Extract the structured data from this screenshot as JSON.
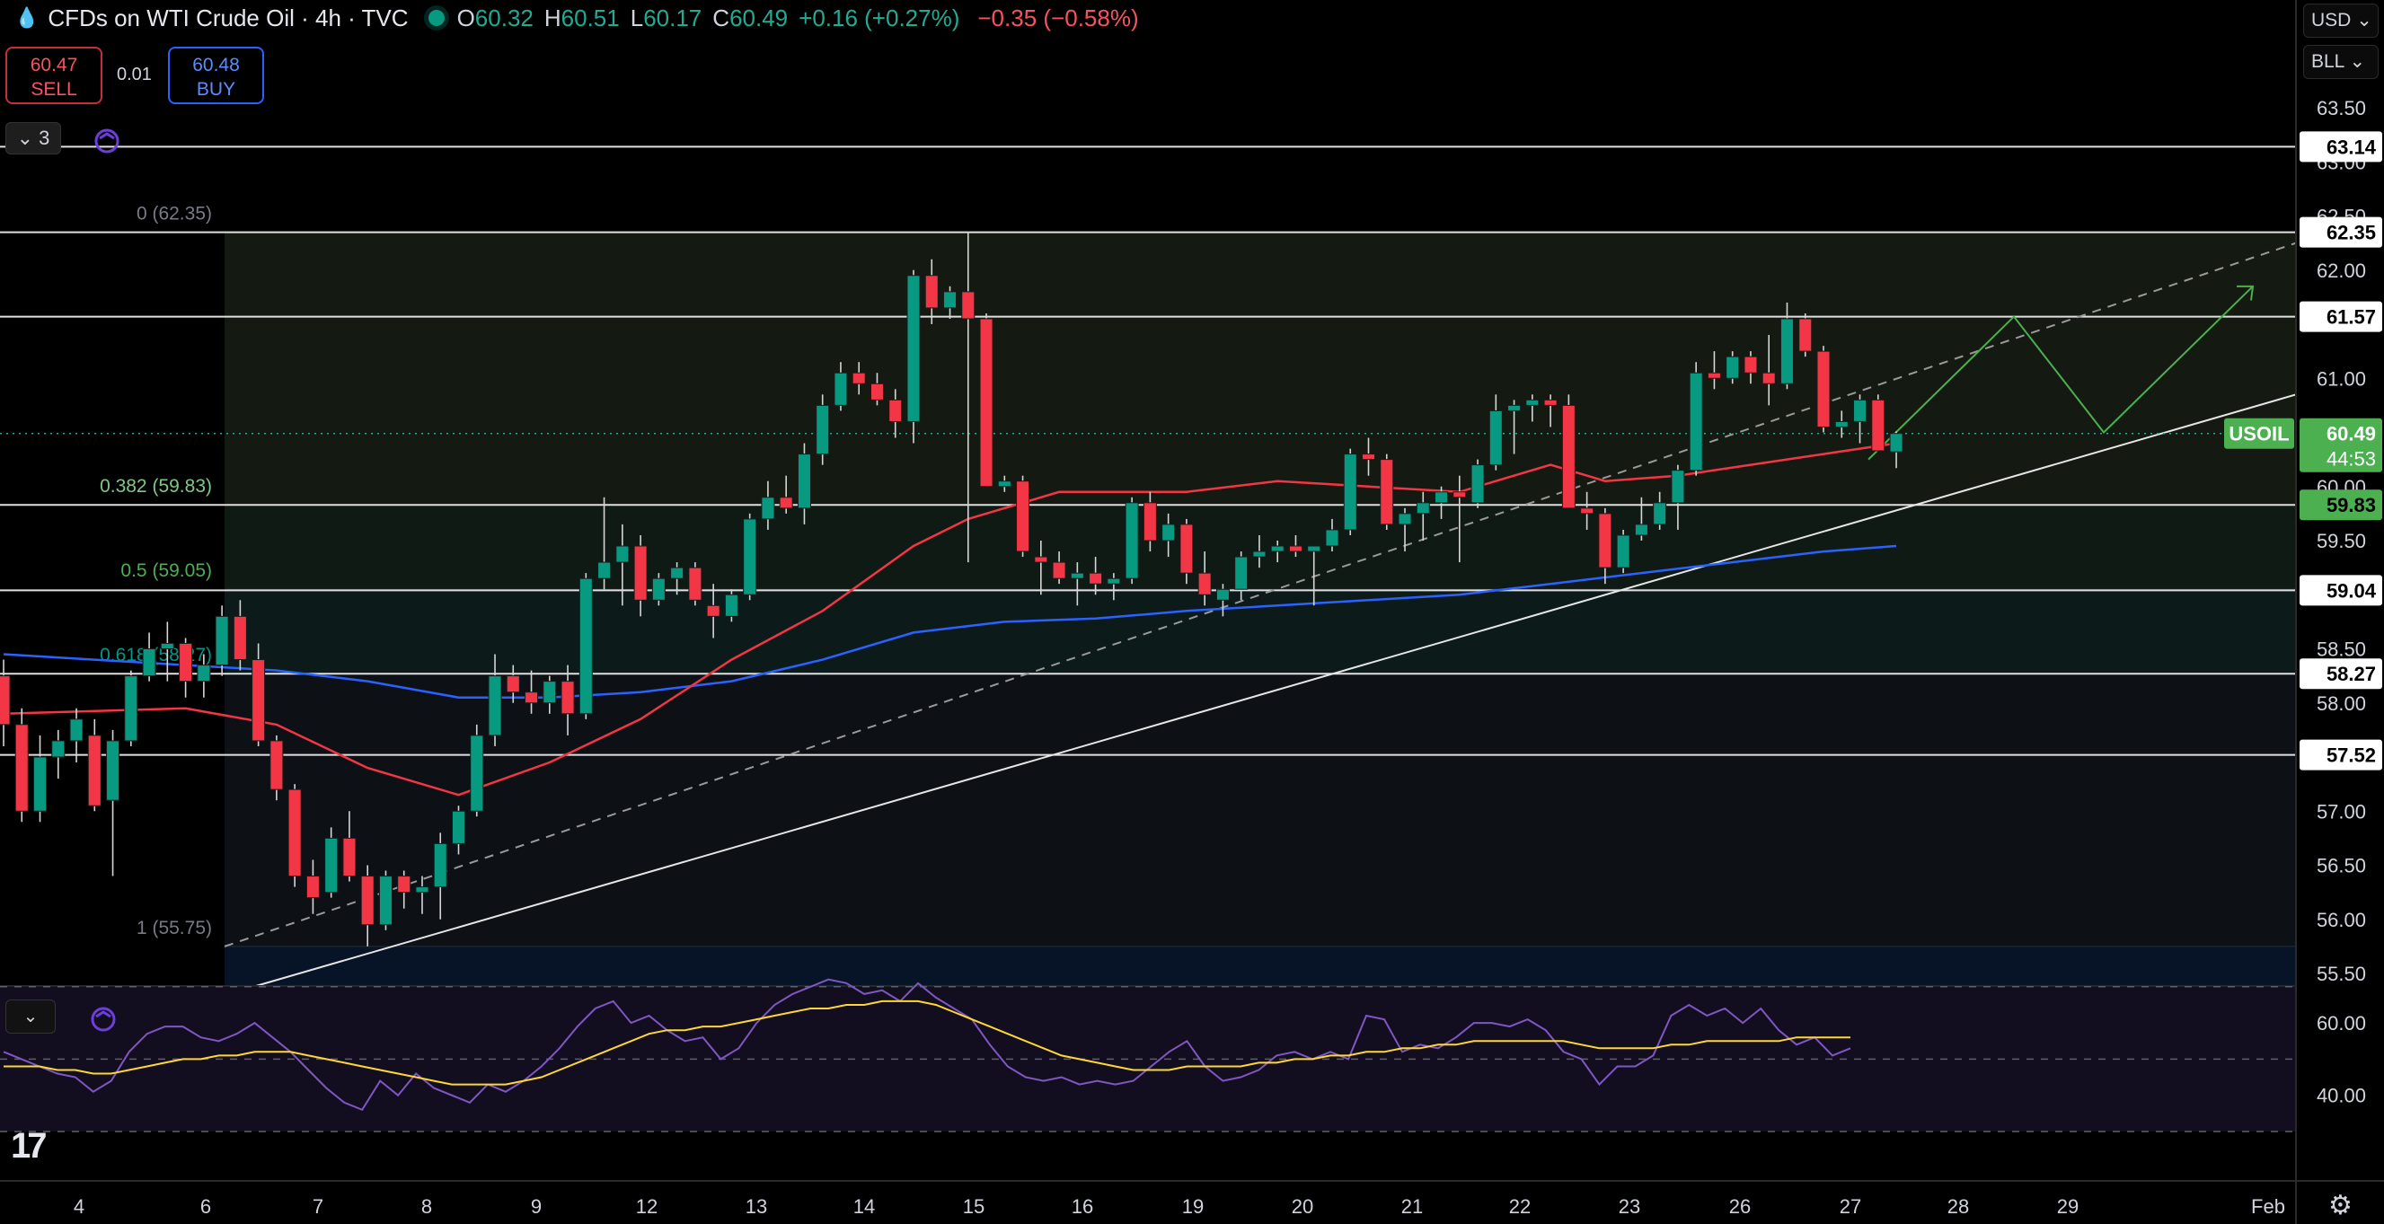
{
  "header": {
    "title": "CFDs on WTI Crude Oil · 4h · TVC",
    "open_label": "O",
    "open": "60.32",
    "high_label": "H",
    "high": "60.51",
    "low_label": "L",
    "low": "60.17",
    "close_label": "C",
    "close": "60.49",
    "change": "+0.16 (+0.27%)",
    "change2": "−0.35 (−0.58%)",
    "status_color": "#089981"
  },
  "trade": {
    "sell_price": "60.47",
    "sell_label": "SELL",
    "spread": "0.01",
    "buy_price": "60.48",
    "buy_label": "BUY"
  },
  "indicators_toggle": {
    "count": "3"
  },
  "currency_select": "USD",
  "unit_select": "BLL",
  "colors": {
    "up": "#089981",
    "down": "#f23645",
    "ma_fast": "#f23645",
    "ma_slow": "#2962ff",
    "rsi": "#7e57c2",
    "rsi_ma": "#fdd835",
    "projection": "#4caf50"
  },
  "chart_data": [
    {
      "type": "candlestick",
      "symbol": "USOIL",
      "timeframe": "4h",
      "x_ticks": [
        "4",
        "6",
        "7",
        "8",
        "9",
        "12",
        "13",
        "14",
        "15",
        "16",
        "19",
        "20",
        "21",
        "22",
        "23",
        "26",
        "27",
        "28",
        "29",
        "Feb"
      ],
      "y_ticks": [
        "63.50",
        "63.00",
        "62.50",
        "62.00",
        "61.50",
        "61.00",
        "60.50",
        "60.00",
        "59.50",
        "59.00",
        "58.50",
        "58.00",
        "57.50",
        "57.00",
        "56.50",
        "56.00",
        "55.50"
      ],
      "ylim": [
        55.4,
        63.9
      ],
      "candles": [
        [
          58.25,
          58.4,
          57.6,
          57.8
        ],
        [
          57.8,
          57.95,
          56.9,
          57.0
        ],
        [
          57.0,
          57.7,
          56.9,
          57.5
        ],
        [
          57.5,
          57.75,
          57.3,
          57.65
        ],
        [
          57.65,
          57.95,
          57.45,
          57.85
        ],
        [
          57.7,
          57.85,
          57.0,
          57.05
        ],
        [
          57.1,
          57.75,
          56.4,
          57.65
        ],
        [
          57.65,
          58.3,
          57.6,
          58.25
        ],
        [
          58.25,
          58.65,
          58.2,
          58.5
        ],
        [
          58.5,
          58.75,
          58.2,
          58.55
        ],
        [
          58.55,
          58.6,
          58.05,
          58.2
        ],
        [
          58.2,
          58.45,
          58.05,
          58.35
        ],
        [
          58.35,
          58.9,
          58.25,
          58.8
        ],
        [
          58.8,
          58.95,
          58.3,
          58.4
        ],
        [
          58.4,
          58.55,
          57.6,
          57.65
        ],
        [
          57.65,
          57.7,
          57.1,
          57.2
        ],
        [
          57.2,
          57.25,
          56.3,
          56.4
        ],
        [
          56.4,
          56.55,
          56.05,
          56.2
        ],
        [
          56.25,
          56.85,
          56.2,
          56.75
        ],
        [
          56.75,
          57.0,
          56.35,
          56.4
        ],
        [
          56.4,
          56.5,
          55.75,
          55.95
        ],
        [
          55.95,
          56.45,
          55.9,
          56.4
        ],
        [
          56.4,
          56.45,
          56.1,
          56.25
        ],
        [
          56.25,
          56.4,
          56.05,
          56.3
        ],
        [
          56.3,
          56.8,
          56.0,
          56.7
        ],
        [
          56.7,
          57.05,
          56.6,
          57.0
        ],
        [
          57.0,
          57.8,
          56.95,
          57.7
        ],
        [
          57.7,
          58.45,
          57.6,
          58.25
        ],
        [
          58.25,
          58.35,
          58.0,
          58.1
        ],
        [
          58.1,
          58.3,
          57.9,
          58.0
        ],
        [
          58.0,
          58.25,
          57.9,
          58.2
        ],
        [
          58.2,
          58.35,
          57.7,
          57.9
        ],
        [
          57.9,
          59.2,
          57.85,
          59.15
        ],
        [
          59.15,
          59.9,
          59.05,
          59.3
        ],
        [
          59.3,
          59.65,
          58.9,
          59.45
        ],
        [
          59.45,
          59.55,
          58.8,
          58.95
        ],
        [
          58.95,
          59.2,
          58.9,
          59.15
        ],
        [
          59.15,
          59.3,
          59.0,
          59.25
        ],
        [
          59.25,
          59.3,
          58.9,
          58.95
        ],
        [
          58.9,
          59.1,
          58.6,
          58.8
        ],
        [
          58.8,
          59.05,
          58.75,
          59.0
        ],
        [
          59.0,
          59.75,
          58.95,
          59.7
        ],
        [
          59.7,
          60.05,
          59.6,
          59.9
        ],
        [
          59.9,
          60.1,
          59.75,
          59.8
        ],
        [
          59.8,
          60.4,
          59.65,
          60.3
        ],
        [
          60.3,
          60.85,
          60.2,
          60.75
        ],
        [
          60.75,
          61.15,
          60.7,
          61.05
        ],
        [
          61.05,
          61.15,
          60.85,
          60.95
        ],
        [
          60.95,
          61.05,
          60.75,
          60.8
        ],
        [
          60.8,
          60.9,
          60.45,
          60.6
        ],
        [
          60.6,
          62.0,
          60.4,
          61.95
        ],
        [
          61.95,
          62.1,
          61.5,
          61.65
        ],
        [
          61.65,
          61.85,
          61.55,
          61.8
        ],
        [
          61.8,
          62.35,
          59.3,
          61.55
        ],
        [
          61.55,
          61.6,
          60.1,
          60.0
        ],
        [
          60.0,
          60.1,
          59.95,
          60.05
        ],
        [
          60.05,
          60.1,
          59.35,
          59.4
        ],
        [
          59.35,
          59.5,
          59.0,
          59.3
        ],
        [
          59.3,
          59.4,
          59.1,
          59.15
        ],
        [
          59.15,
          59.3,
          58.9,
          59.2
        ],
        [
          59.2,
          59.35,
          59.0,
          59.1
        ],
        [
          59.1,
          59.2,
          58.95,
          59.15
        ],
        [
          59.15,
          59.9,
          59.1,
          59.85
        ],
        [
          59.85,
          59.95,
          59.4,
          59.5
        ],
        [
          59.5,
          59.75,
          59.35,
          59.65
        ],
        [
          59.65,
          59.7,
          59.1,
          59.2
        ],
        [
          59.2,
          59.4,
          58.9,
          59.0
        ],
        [
          58.95,
          59.1,
          58.8,
          59.05
        ],
        [
          59.05,
          59.4,
          58.95,
          59.35
        ],
        [
          59.35,
          59.55,
          59.25,
          59.4
        ],
        [
          59.4,
          59.5,
          59.3,
          59.45
        ],
        [
          59.45,
          59.55,
          59.35,
          59.4
        ],
        [
          59.4,
          59.45,
          58.9,
          59.45
        ],
        [
          59.45,
          59.7,
          59.4,
          59.6
        ],
        [
          59.6,
          60.35,
          59.55,
          60.3
        ],
        [
          60.3,
          60.45,
          60.1,
          60.25
        ],
        [
          60.25,
          60.3,
          59.6,
          59.65
        ],
        [
          59.65,
          59.8,
          59.4,
          59.75
        ],
        [
          59.75,
          59.95,
          59.5,
          59.85
        ],
        [
          59.85,
          60.0,
          59.7,
          59.95
        ],
        [
          59.95,
          60.1,
          59.3,
          59.9
        ],
        [
          59.85,
          60.25,
          59.8,
          60.2
        ],
        [
          60.2,
          60.85,
          60.15,
          60.7
        ],
        [
          60.7,
          60.8,
          60.3,
          60.75
        ],
        [
          60.75,
          60.85,
          60.6,
          60.8
        ],
        [
          60.8,
          60.85,
          60.55,
          60.75
        ],
        [
          60.75,
          60.85,
          60.45,
          59.8
        ],
        [
          59.8,
          59.95,
          59.6,
          59.75
        ],
        [
          59.75,
          59.8,
          59.1,
          59.25
        ],
        [
          59.25,
          59.6,
          59.2,
          59.55
        ],
        [
          59.55,
          59.9,
          59.5,
          59.65
        ],
        [
          59.65,
          59.95,
          59.6,
          59.85
        ],
        [
          59.85,
          60.2,
          59.6,
          60.15
        ],
        [
          60.15,
          61.15,
          60.1,
          61.05
        ],
        [
          61.05,
          61.25,
          60.9,
          61.0
        ],
        [
          61.0,
          61.25,
          60.95,
          61.2
        ],
        [
          61.2,
          61.25,
          60.95,
          61.05
        ],
        [
          61.05,
          61.4,
          60.75,
          60.95
        ],
        [
          60.95,
          61.7,
          60.9,
          61.55
        ],
        [
          61.55,
          61.6,
          61.2,
          61.25
        ],
        [
          61.25,
          61.3,
          60.5,
          60.55
        ],
        [
          60.55,
          60.7,
          60.45,
          60.6
        ],
        [
          60.6,
          60.85,
          60.4,
          60.8
        ],
        [
          60.8,
          60.85,
          60.35,
          60.33
        ],
        [
          60.32,
          60.51,
          60.17,
          60.49
        ]
      ],
      "ma_fast": [
        [
          0,
          57.9
        ],
        [
          10,
          57.95
        ],
        [
          15,
          57.8
        ],
        [
          20,
          57.4
        ],
        [
          25,
          57.15
        ],
        [
          30,
          57.45
        ],
        [
          35,
          57.85
        ],
        [
          40,
          58.4
        ],
        [
          45,
          58.85
        ],
        [
          50,
          59.45
        ],
        [
          53,
          59.7
        ],
        [
          58,
          59.95
        ],
        [
          65,
          59.95
        ],
        [
          70,
          60.05
        ],
        [
          75,
          60.0
        ],
        [
          80,
          59.95
        ],
        [
          85,
          60.2
        ],
        [
          88,
          60.05
        ],
        [
          92,
          60.1
        ],
        [
          96,
          60.2
        ],
        [
          100,
          60.3
        ],
        [
          104,
          60.4
        ]
      ],
      "ma_slow": [
        [
          0,
          58.45
        ],
        [
          5,
          58.4
        ],
        [
          10,
          58.35
        ],
        [
          15,
          58.3
        ],
        [
          20,
          58.2
        ],
        [
          25,
          58.05
        ],
        [
          30,
          58.05
        ],
        [
          35,
          58.1
        ],
        [
          40,
          58.2
        ],
        [
          45,
          58.4
        ],
        [
          50,
          58.65
        ],
        [
          55,
          58.75
        ],
        [
          60,
          58.78
        ],
        [
          65,
          58.85
        ],
        [
          70,
          58.9
        ],
        [
          75,
          58.95
        ],
        [
          80,
          59.0
        ],
        [
          85,
          59.1
        ],
        [
          90,
          59.2
        ],
        [
          95,
          59.3
        ],
        [
          100,
          59.4
        ],
        [
          104,
          59.45
        ]
      ],
      "horizontal_levels": [
        "63.14",
        "62.35",
        "61.57",
        "59.83",
        "59.04",
        "58.27",
        "57.52"
      ],
      "fibonacci": [
        {
          "label": "0 (62.35)",
          "value": 62.35,
          "color": "#787b86"
        },
        {
          "label": "0.382 (59.83)",
          "value": 59.83,
          "color": "#81c784"
        },
        {
          "label": "0.5 (59.05)",
          "value": 59.05,
          "color": "#4caf50"
        },
        {
          "label": "0.618 (58.27)",
          "value": 58.27,
          "color": "#009688"
        },
        {
          "label": "1 (55.75)",
          "value": 55.75,
          "color": "#787b86"
        }
      ],
      "last_price": {
        "symbol": "USOIL",
        "price": "60.49",
        "countdown": "44:53"
      }
    },
    {
      "type": "line",
      "panel": "RSI",
      "y_ticks": [
        "60.00",
        "40.00"
      ],
      "ylim": [
        22,
        82
      ],
      "levels": [
        70,
        50,
        30
      ],
      "series": [
        {
          "values": [
            52,
            50,
            48,
            46,
            45,
            41,
            44,
            52,
            57,
            59,
            59,
            56,
            55,
            57,
            60,
            56,
            52,
            47,
            42,
            38,
            36,
            44,
            40,
            46,
            42,
            40,
            38,
            43,
            41,
            44,
            48,
            53,
            59,
            64,
            66,
            60,
            62,
            58,
            55,
            56,
            50,
            53,
            60,
            65,
            68,
            70,
            72,
            71,
            68,
            69,
            66,
            71,
            67,
            64,
            61,
            54,
            48,
            45,
            44,
            45,
            43,
            44,
            43,
            44,
            48,
            52,
            55,
            48,
            44,
            45,
            47,
            51,
            52,
            50,
            52,
            50,
            62,
            61,
            52,
            54,
            53,
            56,
            60,
            60,
            59,
            61,
            58,
            52,
            50,
            43,
            48,
            48,
            51,
            62,
            65,
            62,
            64,
            60,
            64,
            58,
            54,
            56,
            51,
            53
          ]
        },
        {
          "values": [
            48,
            48,
            48,
            47,
            47,
            46,
            46,
            47,
            48,
            49,
            50,
            50,
            51,
            51,
            52,
            52,
            52,
            51,
            50,
            49,
            48,
            47,
            46,
            45,
            44,
            43,
            43,
            43,
            43,
            44,
            45,
            47,
            49,
            51,
            53,
            55,
            57,
            58,
            58,
            59,
            59,
            60,
            61,
            62,
            63,
            64,
            64,
            65,
            65,
            66,
            66,
            66,
            65,
            63,
            61,
            59,
            57,
            55,
            53,
            51,
            50,
            49,
            48,
            47,
            47,
            47,
            48,
            48,
            48,
            48,
            49,
            49,
            50,
            50,
            51,
            51,
            52,
            52,
            53,
            53,
            54,
            54,
            55,
            55,
            55,
            55,
            55,
            55,
            54,
            53,
            53,
            53,
            53,
            54,
            54,
            55,
            55,
            55,
            55,
            55,
            56,
            56,
            56,
            56
          ]
        }
      ]
    }
  ]
}
